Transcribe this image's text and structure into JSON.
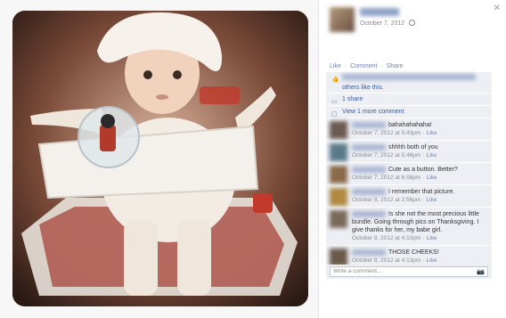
{
  "post": {
    "date": "October 7, 2012",
    "close_icon": "✕"
  },
  "actions": {
    "like": "Like",
    "comment": "Comment",
    "share": "Share",
    "sep": "·"
  },
  "stats": {
    "likes_text": "others like this.",
    "shares": "1 share",
    "view_more": "View 1 more comment"
  },
  "comments": [
    {
      "text": "bahahahahaha!",
      "meta": "October 7, 2012 at 5:43pm",
      "like": "Like",
      "avatar_color": "#6b5a50"
    },
    {
      "text": "shhhh both of you",
      "meta": "October 7, 2012 at 5:46pm",
      "like": "Like",
      "avatar_color": "#5a7a8a"
    },
    {
      "text": "Cute as a button. Better?",
      "meta": "October 7, 2012 at 6:08pm",
      "like": "Like",
      "avatar_color": "#8a6a4a"
    },
    {
      "text": "I remember that picture.",
      "meta": "October 8, 2012 at 2:56pm",
      "like": "Like",
      "avatar_color": "#b08a40"
    },
    {
      "text": "Is she not the most precious little bundle. Going through pics on Thanksgiving. I give thanks for her, my babe girl.",
      "meta": "October 8, 2012 at 4:10pm",
      "like": "Like",
      "avatar_color": "#7a6a5a"
    },
    {
      "text": "THOSE CHEEKS!",
      "meta": "October 8, 2012 at 4:13pm",
      "like": "Like",
      "avatar_color": "#6a5a4a"
    }
  ],
  "write": {
    "placeholder": "Write a comment...",
    "camera_icon": "📷"
  }
}
